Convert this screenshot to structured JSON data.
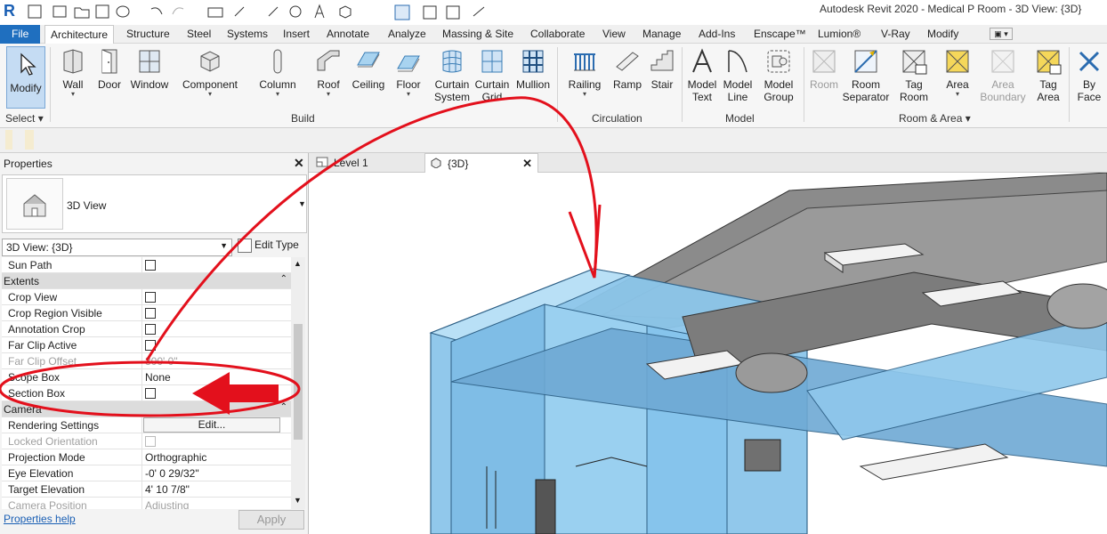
{
  "app": {
    "logo": "R",
    "window_title": "Autodesk Revit 2020 - Medical P Room - 3D View: {3D}"
  },
  "ribbon_tabs": [
    "File",
    "Architecture",
    "Structure",
    "Steel",
    "Systems",
    "Insert",
    "Annotate",
    "Analyze",
    "Massing & Site",
    "Collaborate",
    "View",
    "Manage",
    "Add-Ins",
    "Enscape™",
    "Lumion®",
    "V-Ray",
    "Modify"
  ],
  "ribbon": {
    "select": {
      "modify": "Modify",
      "select_label": "Select"
    },
    "build": {
      "wall": "Wall",
      "door": "Door",
      "window": "Window",
      "component": "Component",
      "column": "Column",
      "roof": "Roof",
      "ceiling": "Ceiling",
      "floor": "Floor",
      "curtain_system_1": "Curtain",
      "curtain_system_2": "System",
      "curtain_grid_1": "Curtain",
      "curtain_grid_2": "Grid",
      "mullion": "Mullion",
      "label": "Build"
    },
    "circulation": {
      "railing": "Railing",
      "ramp": "Ramp",
      "stair": "Stair",
      "label": "Circulation"
    },
    "model": {
      "model_text_1": "Model",
      "model_text_2": "Text",
      "model_line_1": "Model",
      "model_line_2": "Line",
      "model_group_1": "Model",
      "model_group_2": "Group",
      "label": "Model"
    },
    "room_area": {
      "room": "Room",
      "room_sep_1": "Room",
      "room_sep_2": "Separator",
      "tag_room_1": "Tag",
      "tag_room_2": "Room",
      "area": "Area",
      "area_boundary_1": "Area",
      "area_boundary_2": "Boundary",
      "tag_area_1": "Tag",
      "tag_area_2": "Area",
      "label": "Room & Area"
    },
    "opening": {
      "by_face_1": "By",
      "by_face_2": "Face"
    }
  },
  "properties": {
    "title": "Properties",
    "type_name": "3D View",
    "instance": "3D View: {3D}",
    "edit_type": "Edit Type",
    "help": "Properties help",
    "apply": "Apply",
    "rows": {
      "sun_path": "Sun Path",
      "extents": "Extents",
      "crop_view": "Crop View",
      "crop_region_visible": "Crop Region Visible",
      "annotation_crop": "Annotation Crop",
      "far_clip_active": "Far Clip Active",
      "far_clip_offset": "Far Clip Offset",
      "far_clip_offset_val": "300'  0\"",
      "scope_box": "Scope Box",
      "scope_box_val": "None",
      "section_box": "Section Box",
      "camera": "Camera",
      "rendering_settings": "Rendering Settings",
      "rendering_edit": "Edit...",
      "locked_orientation": "Locked Orientation",
      "projection_mode": "Projection Mode",
      "projection_mode_val": "Orthographic",
      "eye_elevation": "Eye Elevation",
      "eye_elevation_val": "-0'  0 29/32\"",
      "target_elevation": "Target Elevation",
      "target_elevation_val": "4'  10 7/8\"",
      "camera_position": "Camera Position",
      "camera_position_val": "Adjusting"
    }
  },
  "view_tabs": {
    "level1": "Level 1",
    "view3d": "{3D}"
  },
  "colors": {
    "file_tab": "#1f6fbf",
    "annotation_red": "#e3101c",
    "glass_blue": "#8cc6ea"
  }
}
